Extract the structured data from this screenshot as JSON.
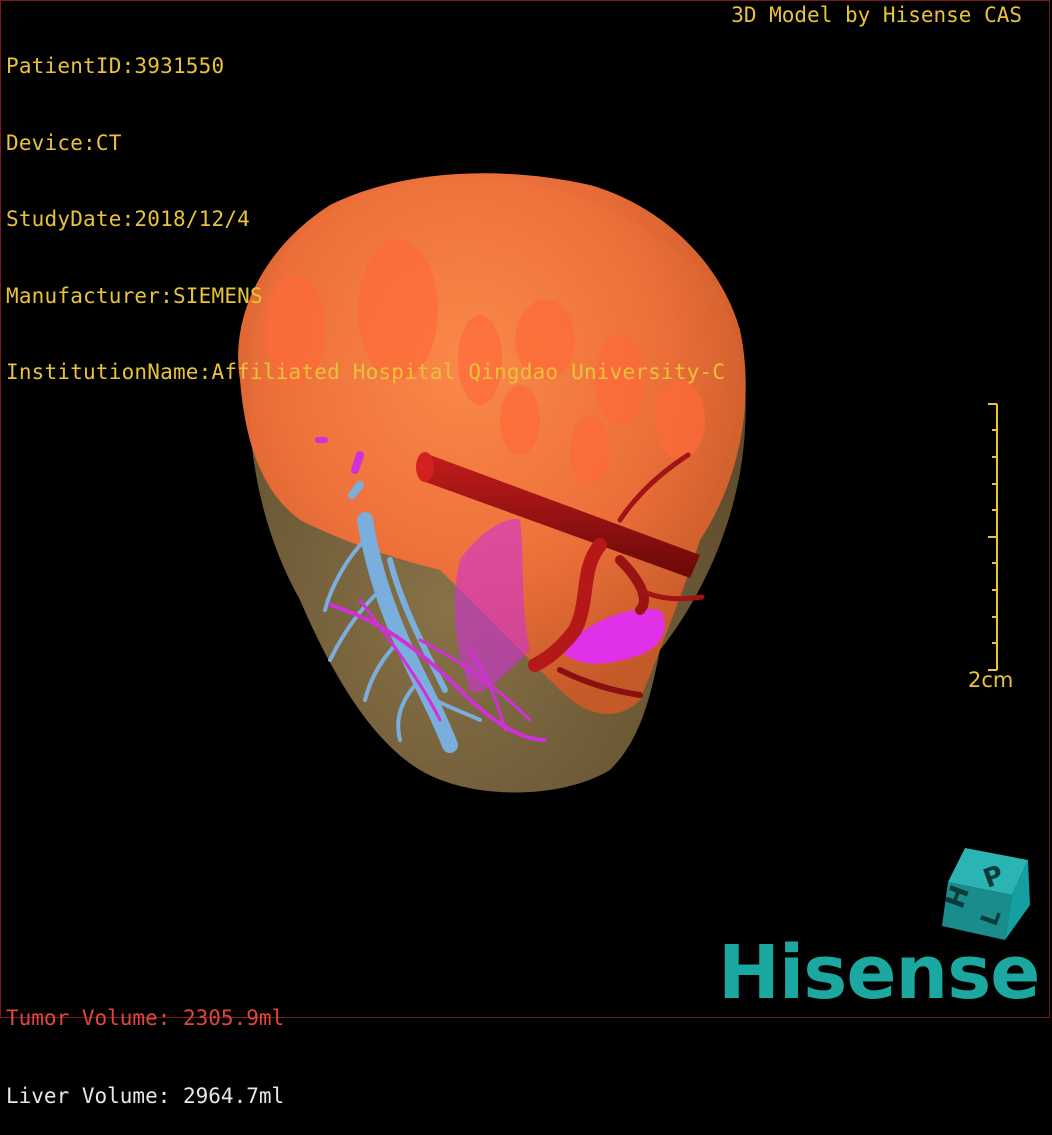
{
  "header": {
    "patient_id": "PatientID:3931550",
    "device": "Device:CT",
    "study_date": "StudyDate:2018/12/4",
    "manufacturer": "Manufacturer:SIEMENS",
    "institution": "InstitutionName:Affiliated Hospital Qingdao University-C"
  },
  "credit": "3D Model by Hisense CAS",
  "volumes": {
    "tumor": "Tumor Volume: 2305.9ml",
    "liver": "Liver Volume: 2964.7ml"
  },
  "scale": {
    "label": "2cm"
  },
  "orientation_cube": {
    "labels": [
      "H",
      "P",
      "L"
    ]
  },
  "brand": {
    "name": "Hisense",
    "color": "#1aa8a0"
  },
  "colors": {
    "text_info": "#e8c33a",
    "tumor_text": "#e0473a",
    "liver_text": "#e6e6e6",
    "liver": "#8c7448",
    "tumor": "#f0703a",
    "artery": "#a01414",
    "portal_vein": "#d030d8",
    "hepatic_vein": "#7aaedc"
  }
}
